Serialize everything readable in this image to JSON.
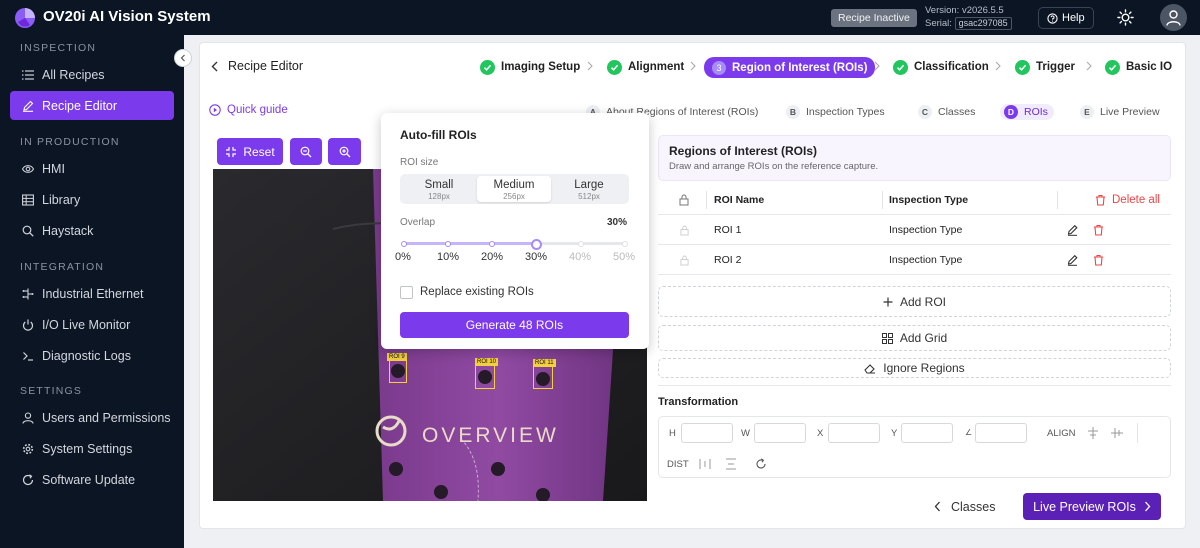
{
  "app": {
    "title": "OV20i AI Vision System",
    "recipe_status": "Recipe Inactive",
    "version": "Version: v2026.5.5",
    "serial_label": "Serial:",
    "serial": "gsac297085",
    "help": "Help"
  },
  "sidebar": {
    "sections": [
      {
        "heading": "INSPECTION",
        "items": [
          {
            "label": "All Recipes",
            "icon": "list-icon"
          },
          {
            "label": "Recipe Editor",
            "icon": "edit-icon",
            "active": true
          }
        ]
      },
      {
        "heading": "IN PRODUCTION",
        "items": [
          {
            "label": "HMI",
            "icon": "eye-icon"
          },
          {
            "label": "Library",
            "icon": "grid-table-icon"
          },
          {
            "label": "Haystack",
            "icon": "search-icon"
          }
        ]
      },
      {
        "heading": "INTEGRATION",
        "items": [
          {
            "label": "Industrial Ethernet",
            "icon": "network-icon"
          },
          {
            "label": "I/O Live Monitor",
            "icon": "power-icon"
          },
          {
            "label": "Diagnostic Logs",
            "icon": "terminal-icon"
          }
        ]
      },
      {
        "heading": "SETTINGS",
        "items": [
          {
            "label": "Users and Permissions",
            "icon": "user-icon"
          },
          {
            "label": "System Settings",
            "icon": "gear-icon"
          },
          {
            "label": "Software Update",
            "icon": "refresh-icon"
          }
        ]
      }
    ]
  },
  "header": {
    "back_label": "Recipe Editor",
    "quick_guide": "Quick guide"
  },
  "steps": [
    {
      "label": "Imaging Setup",
      "state": "done"
    },
    {
      "label": "Alignment",
      "state": "done"
    },
    {
      "number": "3",
      "label": "Region of Interest (ROIs)",
      "state": "active"
    },
    {
      "label": "Classification",
      "state": "done"
    },
    {
      "label": "Trigger",
      "state": "done"
    },
    {
      "label": "Basic IO",
      "state": "done"
    }
  ],
  "substeps": [
    {
      "letter": "A",
      "label": "About Regions of Interest (ROIs)"
    },
    {
      "letter": "B",
      "label": "Inspection Types"
    },
    {
      "letter": "C",
      "label": "Classes"
    },
    {
      "letter": "D",
      "label": "ROIs",
      "active": true
    },
    {
      "letter": "E",
      "label": "Live Preview"
    }
  ],
  "toolbar": {
    "reset": "Reset"
  },
  "canvas": {
    "roi_labels": [
      "ROI 9",
      "ROI 10",
      "ROI 11"
    ],
    "part_text": "OVERVIEW"
  },
  "autofill": {
    "title": "Auto-fill ROIs",
    "size_label": "ROI size",
    "sizes": [
      {
        "name": "Small",
        "px": "128px"
      },
      {
        "name": "Medium",
        "px": "256px",
        "selected": true
      },
      {
        "name": "Large",
        "px": "512px"
      }
    ],
    "overlap_label": "Overlap",
    "overlap_value": "30%",
    "ticks": [
      "0%",
      "10%",
      "20%",
      "30%",
      "40%",
      "50%"
    ],
    "overlap_fraction": 0.6,
    "replace_label": "Replace existing ROIs",
    "replace_checked": false,
    "generate": "Generate 48 ROIs"
  },
  "roi_panel": {
    "title": "Regions of Interest (ROIs)",
    "subtitle": "Draw and arrange ROIs on the reference capture.",
    "col_name": "ROI Name",
    "col_type": "Inspection Type",
    "delete_all": "Delete all",
    "rows": [
      {
        "name": "ROI 1",
        "type": "Inspection Type"
      },
      {
        "name": "ROI 2",
        "type": "Inspection Type"
      }
    ],
    "add_roi": "Add ROI",
    "add_grid": "Add Grid",
    "ignore": "Ignore Regions"
  },
  "transform": {
    "title": "Transformation",
    "h": "H",
    "w": "W",
    "x": "X",
    "y": "Y",
    "angle": "∠",
    "align": "ALIGN",
    "dist": "DIST"
  },
  "footer": {
    "prev": "Classes",
    "next": "Live Preview ROIs"
  },
  "colors": {
    "accent": "#7c3aed",
    "success": "#22c55e",
    "sidebar_bg": "#0c1524",
    "danger": "#ef4444"
  }
}
